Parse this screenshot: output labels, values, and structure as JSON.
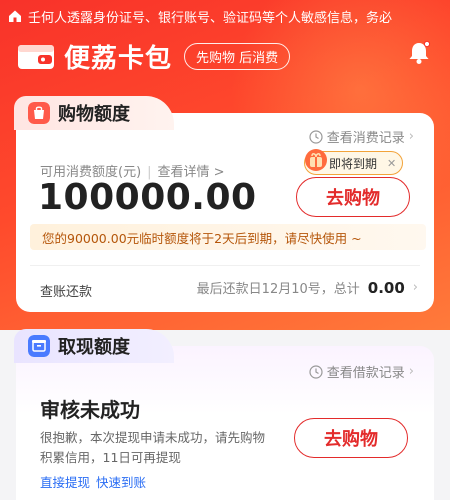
{
  "notice": {
    "text": "壬何人透露身份证号、银行账号、验证码等个人敏感信息，务必"
  },
  "brand": {
    "name": "便荔卡包",
    "slogan": "先购物 后消费",
    "wallet_label": "荔"
  },
  "shopping_card": {
    "title": "购物额度",
    "record_link": "查看消费记录",
    "available_label": "可用消费额度(元)",
    "detail_link": "查看详情 >",
    "amount": "100000.00",
    "expire_badge": "即将到期",
    "shop_button": "去购物",
    "warning": "您的90000.00元临时额度将于2天后到期，请尽快使用 ~",
    "bill_label": "查账还款",
    "due_text": "最后还款日12月10号，",
    "total_label": "总计",
    "total_value": "0.00"
  },
  "cash_card": {
    "title": "取现额度",
    "record_link": "查看借款记录",
    "status": "审核未成功",
    "description": "很抱歉，本次提现申请未成功，请先购物积累信用，11日可再提现",
    "shop_button": "去购物",
    "link1": "直接提现",
    "link2": "快速到账"
  },
  "colors": {
    "brand_red": "#f8322a",
    "button_red": "#e32b2b",
    "warn_text": "#b5560a",
    "link_blue": "#2a6df4"
  }
}
